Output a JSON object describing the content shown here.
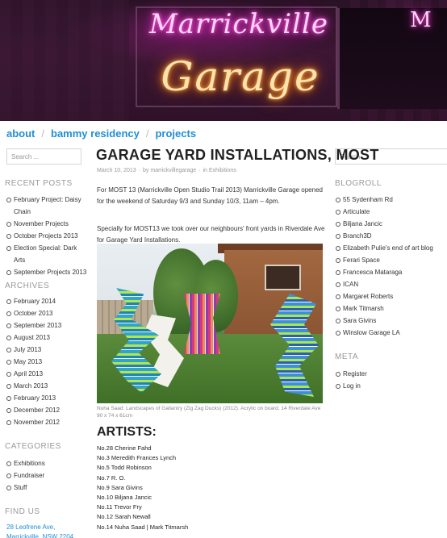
{
  "banner": {
    "neon_top": "Marrickville",
    "neon_bottom": "Garage",
    "neon_side": "M"
  },
  "nav": {
    "items": [
      "about",
      "bammy residency",
      "projects"
    ]
  },
  "search": {
    "placeholder": "Search ..."
  },
  "sidebar_left": {
    "recent_posts": {
      "heading": "RECENT POSTS",
      "items": [
        "February Project: Daisy Chain",
        "November Projects",
        "October Projects 2013",
        "Election Special: Dark Arts",
        "September Projects 2013"
      ]
    },
    "archives": {
      "heading": "ARCHIVES",
      "items": [
        "February 2014",
        "October 2013",
        "September 2013",
        "August 2013",
        "July 2013",
        "May 2013",
        "April 2013",
        "March 2013",
        "February 2013",
        "December 2012",
        "November 2012"
      ]
    },
    "categories": {
      "heading": "CATEGORIES",
      "items": [
        "Exhibitions",
        "Fundraiser",
        "Stuff"
      ]
    },
    "find_us": {
      "heading": "FIND US",
      "address": "28 Leofrene Ave, Marrickville, NSW 2204"
    }
  },
  "post": {
    "title": "GARAGE YARD INSTALLATIONS, MOST",
    "date": "March 10, 2013",
    "by": "by",
    "author": "marrickvillegarage",
    "in": "in",
    "category": "Exhibitions",
    "paragraph1": "For MOST 13 (Marrickville Open Studio Trail 2013) Marrickville Garage opened for the weekend of Saturday 9/3 and Sunday 10/3, 11am – 4pm.",
    "paragraph2": "Specially for MOST13 we took over our neighbours' front yards in Riverdale Ave for Garage Yard Installations.",
    "caption": "Nuha Saad: Landscapes of Gallantry (Zig Zag Ducks) (2012). Acrylic on board. 14 Riverdale Ave 90 x 74 x 61cm",
    "artists_heading": "ARTISTS:",
    "artists": [
      "No.28 Cherine Fahd",
      "No.3 Meredith Frances Lynch",
      "No.5 Todd Robinson",
      "No.7 R. O.",
      "No.9 Sara Givins",
      "No.10 Biljana Jancic",
      "No.11 Trevor Fry",
      "No.12 Sarah Newall",
      "No.14 Nuha Saad | Mark Titmarsh"
    ]
  },
  "sidebar_right": {
    "blogroll": {
      "heading": "BLOGROLL",
      "items": [
        "55 Sydenham Rd",
        "Articulate",
        "Biljana Jancic",
        "Branch3D",
        "Elizabeth Pulie's end of art blog",
        "Ferari Space",
        "Francesca Mataraga",
        "ICAN",
        "Margaret Roberts",
        "Mark Titmarsh",
        "Sara Givins",
        "Winslow Garage LA"
      ]
    },
    "meta": {
      "heading": "META",
      "items": [
        "Register",
        "Log in"
      ]
    }
  }
}
